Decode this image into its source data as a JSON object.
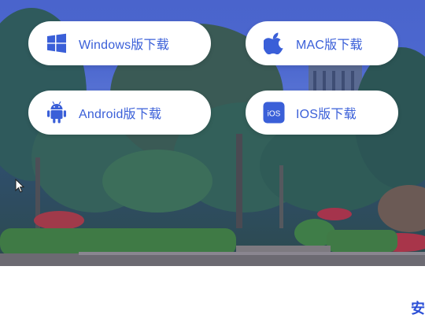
{
  "downloads": [
    {
      "id": "windows",
      "label": "Windows版下载",
      "icon": "windows-logo-icon"
    },
    {
      "id": "mac",
      "label": "MAC版下载",
      "icon": "apple-logo-icon"
    },
    {
      "id": "android",
      "label": "Android版下载",
      "icon": "android-logo-icon"
    },
    {
      "id": "ios",
      "label": "IOS版下载",
      "icon": "ios-badge-icon",
      "icon_text": "iOS"
    }
  ],
  "footer": {
    "partial_heading": "安"
  },
  "colors": {
    "accent": "#3a5fd8",
    "button_bg": "#ffffff",
    "sky": "#4a64cc"
  }
}
